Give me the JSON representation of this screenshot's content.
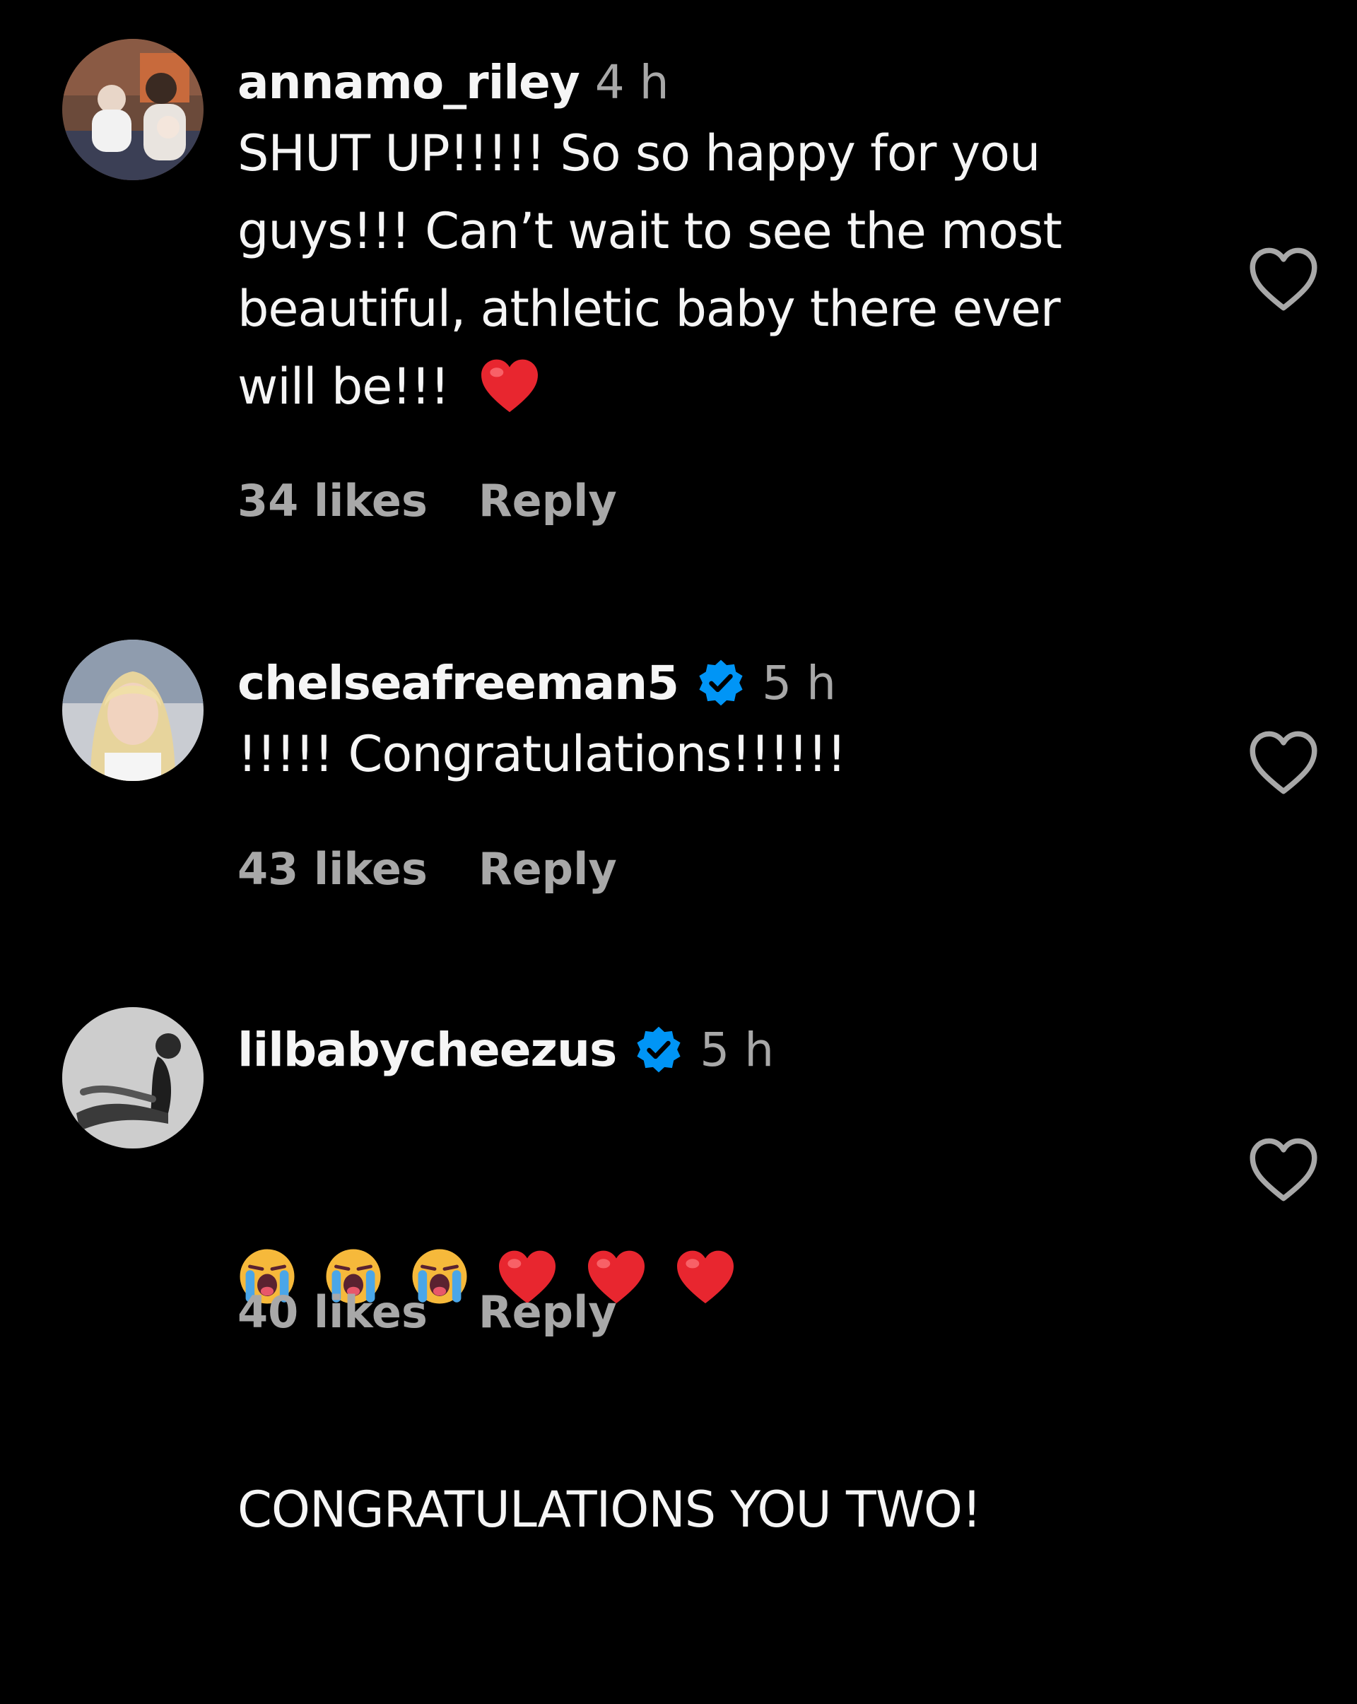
{
  "colors": {
    "background": "#000000",
    "text": "#f5f5f5",
    "muted": "#a8a8a8",
    "verified": "#0095f6",
    "heart_emoji": "#e8262f"
  },
  "comments": [
    {
      "username": "annamo_riley",
      "time": "4 h",
      "verified": false,
      "text_lines": [
        "SHUT UP!!!!! So so happy for you",
        "guys!!! Can’t wait to see the most",
        "beautiful, athletic baby there ever",
        "will be!!! "
      ],
      "trailing_emoji": "red-heart",
      "likes": "34 likes",
      "reply": "Reply",
      "like_icon": "heart-outline-icon"
    },
    {
      "username": "chelseafreeman5",
      "time": "5 h",
      "verified": true,
      "text_lines": [
        "!!!!! Congratulations!!!!!!"
      ],
      "likes": "43 likes",
      "reply": "Reply",
      "like_icon": "heart-outline-icon"
    },
    {
      "username": "lilbabycheezus",
      "time": "5 h",
      "verified": true,
      "emoji_line": [
        "loudly-crying-face",
        "loudly-crying-face",
        "loudly-crying-face",
        "red-heart",
        "red-heart",
        "red-heart"
      ],
      "text_lines": [
        "CONGRATULATIONS YOU TWO!"
      ],
      "likes": "40 likes",
      "reply": "Reply",
      "like_icon": "heart-outline-icon"
    }
  ]
}
